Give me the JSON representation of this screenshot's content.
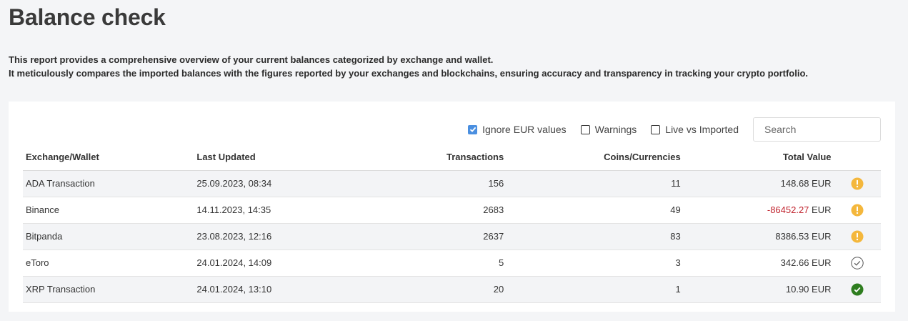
{
  "page": {
    "title": "Balance check",
    "description_line1": "This report provides a comprehensive overview of your current balances categorized by exchange and wallet.",
    "description_line2": "It meticulously compares the imported balances with the figures reported by your exchanges and blockchains, ensuring accuracy and transparency in tracking your crypto portfolio."
  },
  "filters": {
    "ignore_eur": {
      "label": "Ignore EUR values",
      "checked": true
    },
    "warnings": {
      "label": "Warnings",
      "checked": false
    },
    "live_vs_imported": {
      "label": "Live vs Imported",
      "checked": false
    },
    "search_placeholder": "Search"
  },
  "table": {
    "headers": {
      "exchange": "Exchange/Wallet",
      "last_updated": "Last Updated",
      "transactions": "Transactions",
      "coins": "Coins/Currencies",
      "total_value": "Total Value"
    },
    "rows": [
      {
        "name": "ADA Transaction",
        "updated": "25.09.2023, 08:34",
        "transactions": "156",
        "coins": "11",
        "amount": "148.68",
        "currency": "EUR",
        "negative": false,
        "status": "warning-icon"
      },
      {
        "name": "Binance",
        "updated": "14.11.2023, 14:35",
        "transactions": "2683",
        "coins": "49",
        "amount": "-86452.27",
        "currency": "EUR",
        "negative": true,
        "status": "warning-icon"
      },
      {
        "name": "Bitpanda",
        "updated": "23.08.2023, 12:16",
        "transactions": "2637",
        "coins": "83",
        "amount": "8386.53",
        "currency": "EUR",
        "negative": false,
        "status": "warning-icon"
      },
      {
        "name": "eToro",
        "updated": "24.01.2024, 14:09",
        "transactions": "5",
        "coins": "3",
        "amount": "342.66",
        "currency": "EUR",
        "negative": false,
        "status": "check-outline-icon"
      },
      {
        "name": "XRP Transaction",
        "updated": "24.01.2024, 13:10",
        "transactions": "20",
        "coins": "1",
        "amount": "10.90",
        "currency": "EUR",
        "negative": false,
        "status": "check-filled-icon"
      }
    ]
  },
  "colors": {
    "warning": "#f4b73c",
    "ok": "#2e7d1f",
    "negative": "#c0232d",
    "checkbox_accent": "#4a8fe0"
  }
}
